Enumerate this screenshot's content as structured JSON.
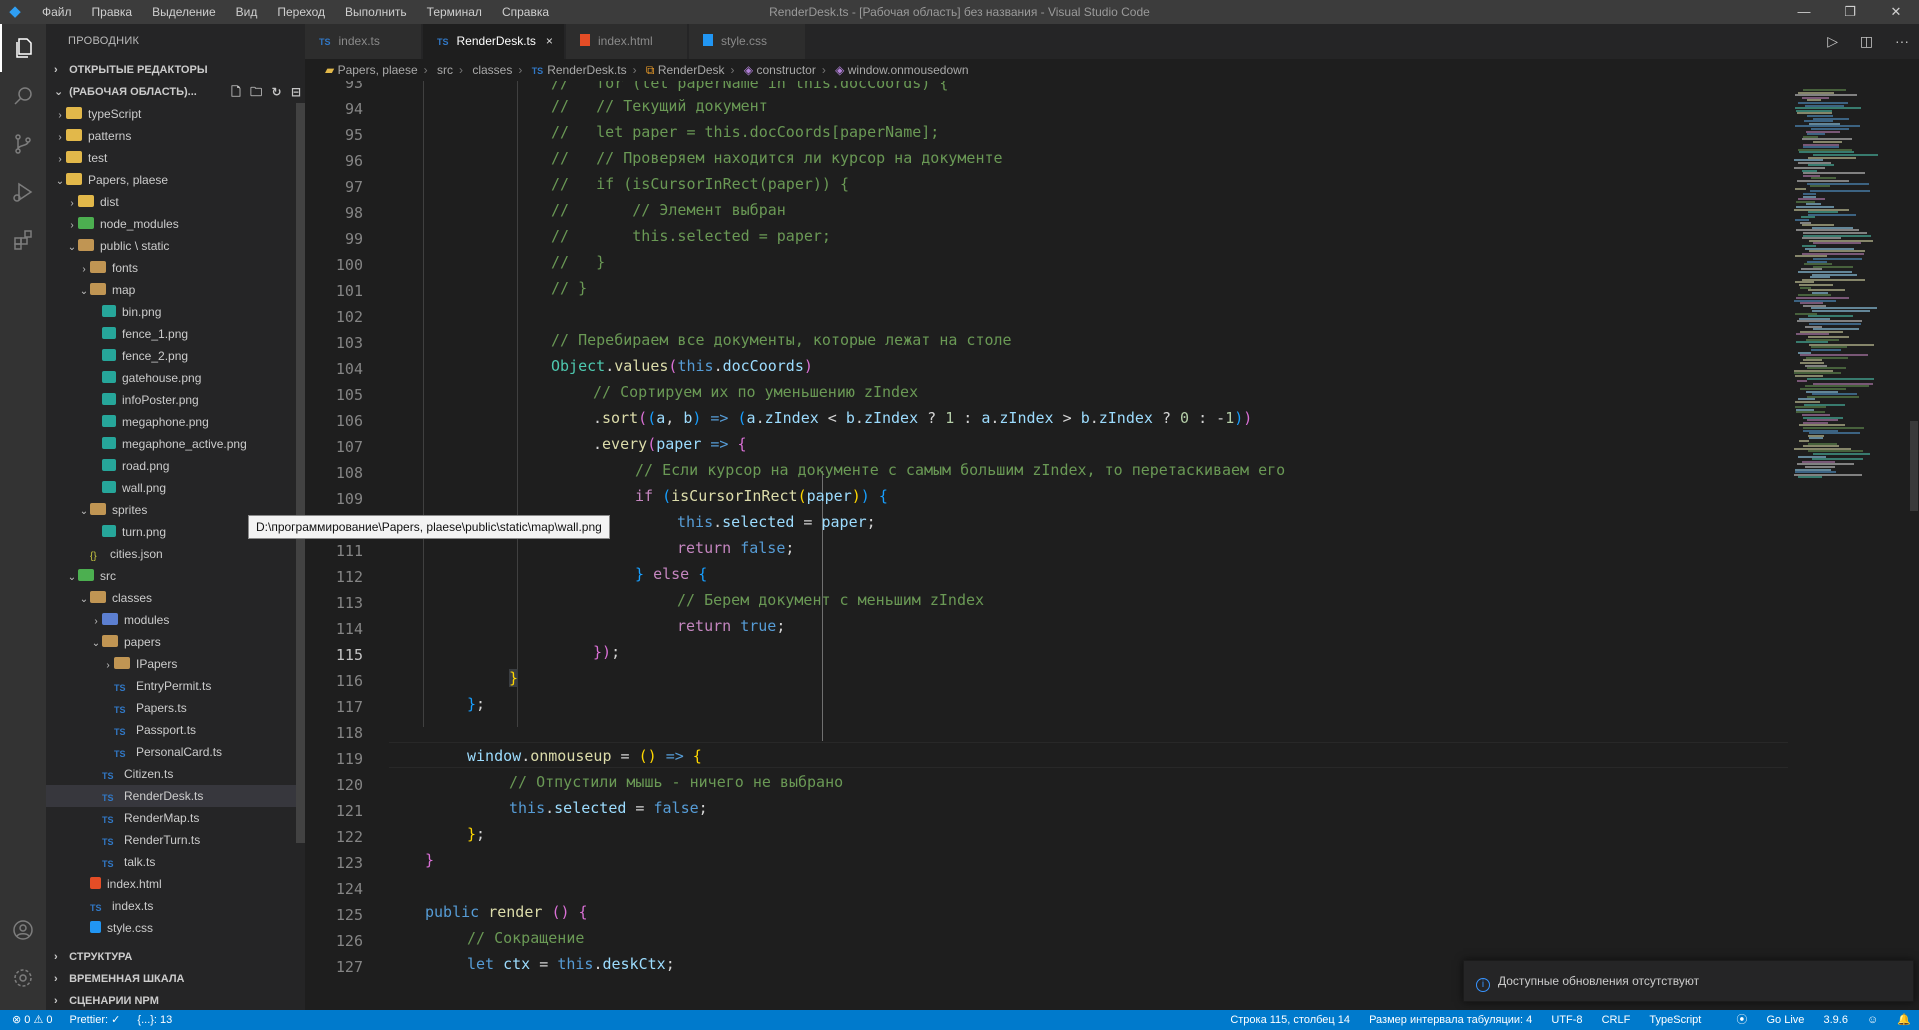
{
  "titlebar": {
    "menu": [
      "Файл",
      "Правка",
      "Выделение",
      "Вид",
      "Переход",
      "Выполнить",
      "Терминал",
      "Справка"
    ],
    "window_title": "RenderDesk.ts - [Рабочая область] без названия - Visual Studio Code",
    "controls": [
      "—",
      "❐",
      "✕"
    ]
  },
  "activitybar": {
    "icons": [
      "explorer-icon",
      "search-icon",
      "source-control-icon",
      "run-debug-icon",
      "extensions-icon",
      "account-icon",
      "settings-gear-icon"
    ]
  },
  "sidebar": {
    "header": "ПРОВОДНИК",
    "open_editors": "ОТКРЫТЫЕ РЕДАКТОРЫ",
    "workspace": "(РАБОЧАЯ ОБЛАСТЬ)...",
    "tree": [
      {
        "label": "typeScript",
        "depth": 1,
        "chev": "›",
        "icon": "folder-special"
      },
      {
        "label": "patterns",
        "depth": 1,
        "chev": "›",
        "icon": "folder-special"
      },
      {
        "label": "test",
        "depth": 1,
        "chev": "›",
        "icon": "folder-special"
      },
      {
        "label": "Papers, plaese",
        "depth": 1,
        "chev": "⌄",
        "icon": "folder-special"
      },
      {
        "label": "dist",
        "depth": 2,
        "chev": "›",
        "icon": "folder-special"
      },
      {
        "label": "node_modules",
        "depth": 2,
        "chev": "›",
        "icon": "folder-green"
      },
      {
        "label": "public \\ static",
        "depth": 2,
        "chev": "⌄",
        "icon": "folder"
      },
      {
        "label": "fonts",
        "depth": 3,
        "chev": "›",
        "icon": "folder"
      },
      {
        "label": "map",
        "depth": 3,
        "chev": "⌄",
        "icon": "folder"
      },
      {
        "label": "bin.png",
        "depth": 4,
        "chev": "",
        "icon": "png"
      },
      {
        "label": "fence_1.png",
        "depth": 4,
        "chev": "",
        "icon": "png"
      },
      {
        "label": "fence_2.png",
        "depth": 4,
        "chev": "",
        "icon": "png"
      },
      {
        "label": "gatehouse.png",
        "depth": 4,
        "chev": "",
        "icon": "png"
      },
      {
        "label": "infoPoster.png",
        "depth": 4,
        "chev": "",
        "icon": "png"
      },
      {
        "label": "megaphone.png",
        "depth": 4,
        "chev": "",
        "icon": "png"
      },
      {
        "label": "megaphone_active.png",
        "depth": 4,
        "chev": "",
        "icon": "png"
      },
      {
        "label": "road.png",
        "depth": 4,
        "chev": "",
        "icon": "png"
      },
      {
        "label": "wall.png",
        "depth": 4,
        "chev": "",
        "icon": "png"
      },
      {
        "label": "sprites",
        "depth": 3,
        "chev": "⌄",
        "icon": "folder"
      },
      {
        "label": "turn.png",
        "depth": 4,
        "chev": "",
        "icon": "png"
      },
      {
        "label": "cities.json",
        "depth": 3,
        "chev": "",
        "icon": "json"
      },
      {
        "label": "src",
        "depth": 2,
        "chev": "⌄",
        "icon": "folder-green"
      },
      {
        "label": "classes",
        "depth": 3,
        "chev": "⌄",
        "icon": "folder"
      },
      {
        "label": "modules",
        "depth": 4,
        "chev": "›",
        "icon": "folder-blue"
      },
      {
        "label": "papers",
        "depth": 4,
        "chev": "⌄",
        "icon": "folder"
      },
      {
        "label": "IPapers",
        "depth": 5,
        "chev": "›",
        "icon": "folder"
      },
      {
        "label": "EntryPermit.ts",
        "depth": 5,
        "chev": "",
        "icon": "ts"
      },
      {
        "label": "Papers.ts",
        "depth": 5,
        "chev": "",
        "icon": "ts"
      },
      {
        "label": "Passport.ts",
        "depth": 5,
        "chev": "",
        "icon": "ts"
      },
      {
        "label": "PersonalCard.ts",
        "depth": 5,
        "chev": "",
        "icon": "ts"
      },
      {
        "label": "Citizen.ts",
        "depth": 4,
        "chev": "",
        "icon": "ts"
      },
      {
        "label": "RenderDesk.ts",
        "depth": 4,
        "chev": "",
        "icon": "ts",
        "selected": true
      },
      {
        "label": "RenderMap.ts",
        "depth": 4,
        "chev": "",
        "icon": "ts"
      },
      {
        "label": "RenderTurn.ts",
        "depth": 4,
        "chev": "",
        "icon": "ts"
      },
      {
        "label": "talk.ts",
        "depth": 4,
        "chev": "",
        "icon": "ts"
      },
      {
        "label": "index.html",
        "depth": 3,
        "chev": "",
        "icon": "html"
      },
      {
        "label": "index.ts",
        "depth": 3,
        "chev": "",
        "icon": "ts"
      },
      {
        "label": "style.css",
        "depth": 3,
        "chev": "",
        "icon": "css"
      }
    ],
    "bottom_sections": [
      "СТРУКТУРА",
      "ВРЕМЕННАЯ ШКАЛА",
      "СЦЕНАРИИ NPM"
    ]
  },
  "tabs": [
    {
      "label": "index.ts",
      "icon": "TS",
      "active": false
    },
    {
      "label": "RenderDesk.ts",
      "icon": "TS",
      "active": true,
      "close": "×"
    },
    {
      "label": "index.html",
      "icon": "html",
      "active": false
    },
    {
      "label": "style.css",
      "icon": "css",
      "active": false
    }
  ],
  "breadcrumb": [
    "Papers, plaese",
    "src",
    "classes",
    "RenderDesk.ts",
    "RenderDesk",
    "constructor",
    "window.onmousedown"
  ],
  "editor": {
    "line_numbers": [
      "93",
      "94",
      "95",
      "96",
      "97",
      "98",
      "99",
      "100",
      "101",
      "102",
      "103",
      "104",
      "105",
      "106",
      "107",
      "108",
      "109",
      "110",
      "111",
      "112",
      "113",
      "114",
      "115",
      "116",
      "117",
      "118",
      "119",
      "120",
      "121",
      "122",
      "123",
      "124",
      "125",
      "126",
      "127"
    ],
    "current_line": "115"
  },
  "tooltip": "D:\\программирование\\Papers, plaese\\public\\static\\map\\wall.png",
  "notification": "Доступные обновления отсутствуют",
  "statusbar": {
    "left": [
      "⊗ 0  ⚠ 0",
      "Prettier: ✓",
      "{...}: 13"
    ],
    "right": [
      "Строка 115, столбец 14",
      "Размер интервала табуляции: 4",
      "UTF-8",
      "CRLF",
      "TypeScript",
      "Go Live",
      "3.9.6"
    ]
  },
  "colors": {
    "accent": "#007acc",
    "editor_bg": "#1e1e1e",
    "sidebar_bg": "#252526",
    "comment": "#6a9955",
    "keyword": "#569cd6"
  }
}
